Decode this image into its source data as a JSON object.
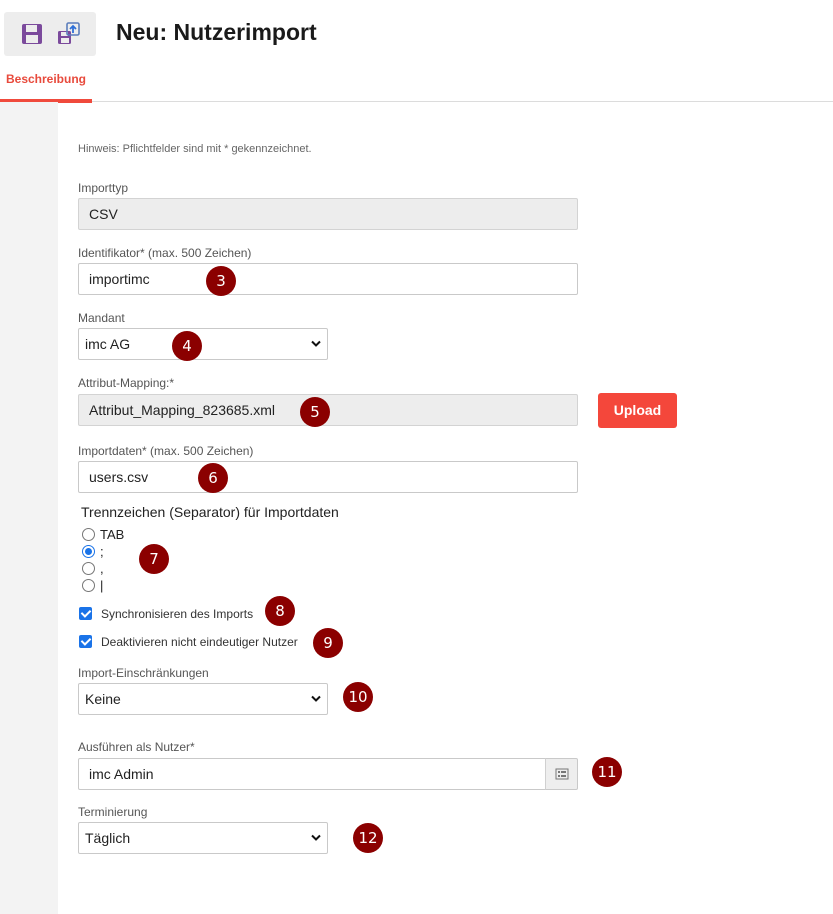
{
  "header": {
    "title": "Neu: Nutzerimport",
    "toolbar_icons": [
      "save-icon",
      "save-and-import-icon"
    ]
  },
  "tabs": [
    {
      "label": "Beschreibung",
      "active": true
    }
  ],
  "form": {
    "hint": "Hinweis: Pflichtfelder sind mit * gekennzeichnet.",
    "importtyp": {
      "label": "Importtyp",
      "value": "CSV"
    },
    "identifikator": {
      "label": "Identifikator* (max. 500 Zeichen)",
      "value": "importimc"
    },
    "mandant": {
      "label": "Mandant",
      "value": "imc AG"
    },
    "attribut_mapping": {
      "label": "Attribut-Mapping:*",
      "value": "Attribut_Mapping_823685.xml",
      "upload_label": "Upload"
    },
    "importdaten": {
      "label": "Importdaten* (max. 500 Zeichen)",
      "value": "users.csv"
    },
    "separator": {
      "label": "Trennzeichen (Separator) für Importdaten",
      "options": [
        "TAB",
        ";",
        ",",
        "|"
      ],
      "selected": ";"
    },
    "synchronisieren": {
      "label": "Synchronisieren des Imports",
      "checked": true
    },
    "deaktivieren": {
      "label": "Deaktivieren nicht eindeutiger Nutzer",
      "checked": true
    },
    "einschraenkungen": {
      "label": "Import-Einschränkungen",
      "value": "Keine"
    },
    "ausfuehren_als": {
      "label": "Ausführen als Nutzer*",
      "value": "imc Admin"
    },
    "terminierung": {
      "label": "Terminierung",
      "value": "Täglich"
    }
  },
  "annotations": [
    "3",
    "4",
    "5",
    "6",
    "7",
    "8",
    "9",
    "10",
    "11",
    "12"
  ],
  "colors": {
    "accent": "#f4473b",
    "badge": "#8b0000",
    "checkbox": "#1a73e8",
    "readonly_bg": "#ededed"
  }
}
